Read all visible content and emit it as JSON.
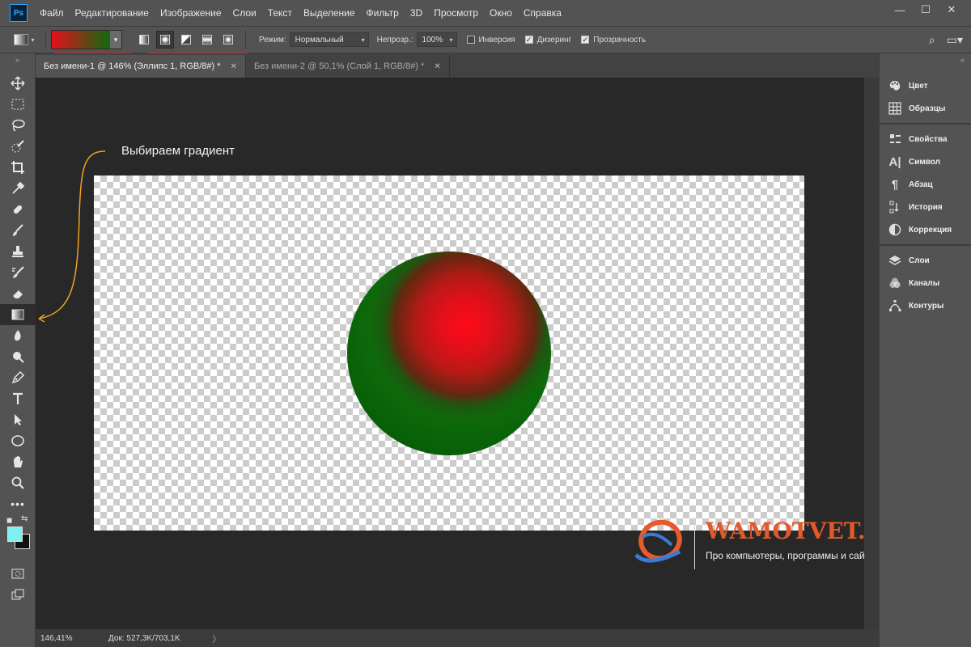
{
  "app": {
    "logo": "Ps"
  },
  "menu": [
    "Файл",
    "Редактирование",
    "Изображение",
    "Слои",
    "Текст",
    "Выделение",
    "Фильтр",
    "3D",
    "Просмотр",
    "Окно",
    "Справка"
  ],
  "window_controls": {
    "minimize": "—",
    "maximize": "☐",
    "close": "✕"
  },
  "options": {
    "mode_label": "Режим:",
    "mode_value": "Нормальный",
    "opacity_label": "Непрозр.:",
    "opacity_value": "100%",
    "invert_label": "Инверсия",
    "invert_checked": false,
    "dither_label": "Дизеринг",
    "dither_checked": true,
    "transparency_label": "Прозрачность",
    "transparency_checked": true,
    "gradient_colors": [
      "#e6101a",
      "#0f6a10"
    ]
  },
  "tabs": [
    {
      "label": "Без имени-1 @ 146% (Эллипс 1, RGB/8#) *",
      "active": true
    },
    {
      "label": "Без имени-2 @ 50,1% (Слой 1, RGB/8#) *",
      "active": false
    }
  ],
  "annotation": "Выбираем градиент",
  "watermark": {
    "title": "WAMOTVET.RU",
    "subtitle": "Про компьютеры, программы и сайты"
  },
  "status": {
    "zoom": "146,41%",
    "doc": "Док: 527,3K/703,1K",
    "arrow": "〉"
  },
  "panels": {
    "group1": [
      "Цвет",
      "Образцы"
    ],
    "group2": [
      "Свойства",
      "Символ",
      "Абзац",
      "История",
      "Коррекция"
    ],
    "group3": [
      "Слои",
      "Каналы",
      "Контуры"
    ]
  },
  "colors": {
    "foreground": "#7ff0f0",
    "background": "#111111",
    "accent": "#f2a020"
  }
}
